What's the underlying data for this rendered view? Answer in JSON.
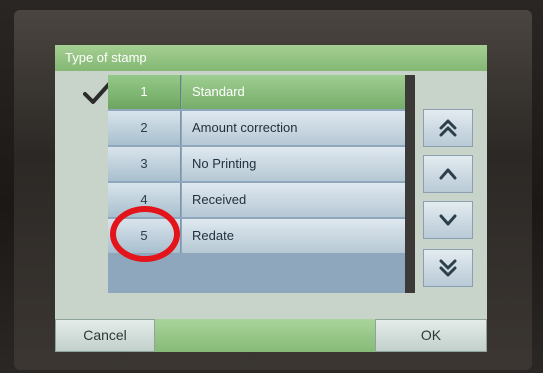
{
  "screen": {
    "title": "Type of stamp"
  },
  "list": {
    "selected_index": 0,
    "rows": [
      {
        "number": "1",
        "label": "Standard"
      },
      {
        "number": "2",
        "label": "Amount correction"
      },
      {
        "number": "3",
        "label": "No Printing"
      },
      {
        "number": "4",
        "label": "Received"
      },
      {
        "number": "5",
        "label": "Redate"
      }
    ]
  },
  "nav": {
    "icons": [
      "double-chevron-up-icon",
      "chevron-up-icon",
      "chevron-down-icon",
      "double-chevron-down-icon"
    ]
  },
  "footer": {
    "cancel_label": "Cancel",
    "ok_label": "OK"
  },
  "colors": {
    "accent_green": "#86ba77",
    "list_blue": "#b6c8d5",
    "annotation_red": "#e4141b"
  }
}
